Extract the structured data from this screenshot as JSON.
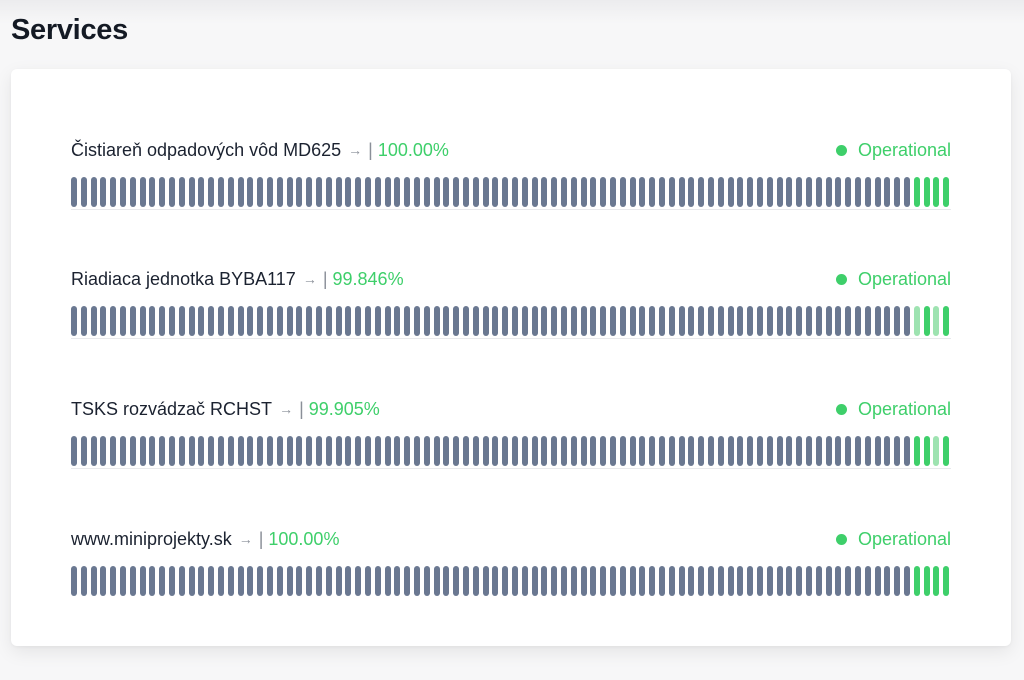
{
  "page": {
    "title": "Services"
  },
  "services": [
    {
      "name": "Čistiareň odpadových vôd MD625",
      "uptime": "100.00%",
      "status": "Operational",
      "tail_states": [
        "up",
        "up",
        "up",
        "up"
      ]
    },
    {
      "name": "Riadiaca jednotka BYBA117",
      "uptime": "99.846%",
      "status": "Operational",
      "tail_states": [
        "partial",
        "up",
        "partial",
        "up"
      ]
    },
    {
      "name": "TSKS rozvádzač RCHST",
      "uptime": "99.905%",
      "status": "Operational",
      "tail_states": [
        "up",
        "up",
        "partial",
        "up"
      ]
    },
    {
      "name": "www.miniprojekty.sk",
      "uptime": "100.00%",
      "status": "Operational",
      "tail_states": [
        "up",
        "up",
        "up",
        "up"
      ]
    }
  ],
  "history_bar_count": 90,
  "icons": {
    "arrow": "→",
    "separator": "|"
  },
  "colors": {
    "operational": "#3ecf6a",
    "degraded": "#9ee3b1",
    "no_data": "#6a7891",
    "title": "#141a24"
  }
}
